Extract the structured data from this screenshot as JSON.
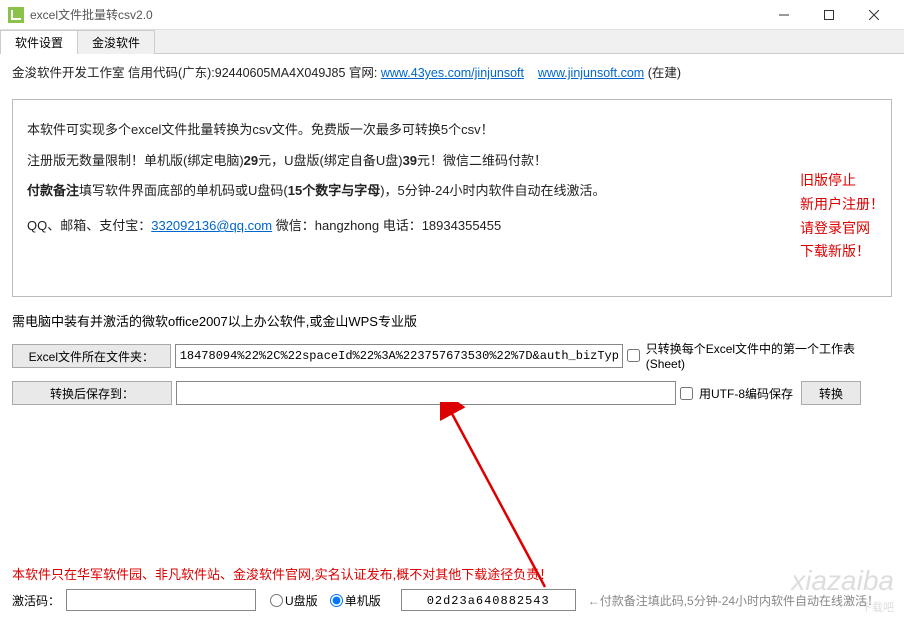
{
  "window": {
    "title": "excel文件批量转csv2.0"
  },
  "tabs": {
    "active": "软件设置",
    "inactive": "金浚软件"
  },
  "header": {
    "company": "金浚软件开发工作室 信用代码(广东):92440605MA4X049J85 官网:",
    "url1": "www.43yes.com/jinjunsoft",
    "url2": "www.jinjunsoft.com",
    "suffix": "(在建)"
  },
  "info": {
    "l1": "本软件可实现多个excel文件批量转换为csv文件。免费版一次最多可转换5个csv！",
    "l2a": "注册版无数量限制！单机版(绑定电脑)",
    "l2b": "29",
    "l2c": "元，U盘版(绑定自备U盘)",
    "l2d": "39",
    "l2e": "元！微信二维码付款！",
    "l3a": "付款备注",
    "l3b": "填写软件界面底部的单机码或U盘码(",
    "l3c": "15个数字与字母",
    "l3d": ")，5分钟-24小时内软件自动在线激活。",
    "l4a": "QQ、邮箱、支付宝：",
    "l4b": "332092136@qq.com",
    "l4c": "  微信：hangzhong   电话：18934355455"
  },
  "side": {
    "l1": "旧版停止",
    "l2": "新用户注册！",
    "l3": "请登录官网",
    "l4": "下载新版！"
  },
  "req": "需电脑中装有并激活的微软office2007以上办公软件,或金山WPS专业版",
  "row1": {
    "btn": "Excel文件所在文件夹：",
    "value": "18478094%22%2C%22spaceId%22%3A%223757673530%22%7D&auth_bizType=DINGDRIVE",
    "chk": "只转换每个Excel文件中的第一个工作表(Sheet)"
  },
  "row2": {
    "btn": "转换后保存到：",
    "chk": "用UTF-8编码保存",
    "convert": "转换"
  },
  "bottom": {
    "warn": "本软件只在华军软件园、非凡软件站、金浚软件官网,实名认证发布,概不对其他下载途径负责！",
    "act_label": "激活码：",
    "r_upan": "U盘版",
    "r_danji": "单机版",
    "code": "02d23a640882543",
    "hint": "←付款备注填此码,5分钟-24小时内软件自动在线激活！"
  },
  "watermark": {
    "en": "xiazaiba",
    "cn": "下载吧"
  }
}
